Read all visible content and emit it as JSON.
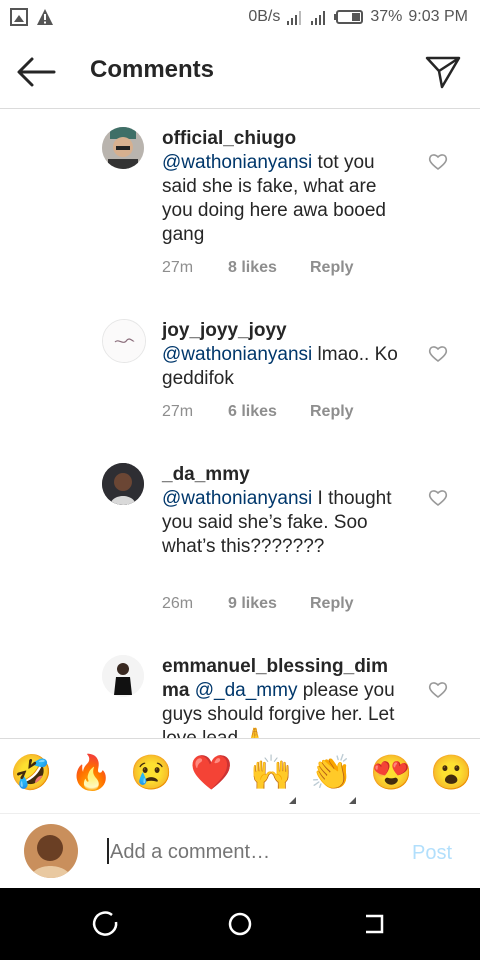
{
  "statusbar": {
    "network_speed": "0B/s",
    "battery": "37%",
    "time": "9:03 PM",
    "icons": [
      "image-icon",
      "warning-icon",
      "signal-icon",
      "signal-icon",
      "battery-icon"
    ]
  },
  "header": {
    "title": "Comments"
  },
  "comments": [
    {
      "username": "official_chiugo",
      "mention": "@wathonianyansi",
      "text": " tot you said she is fake, what are you doing here awa booed gang",
      "time": "27m",
      "likes": "8 likes",
      "reply": "Reply"
    },
    {
      "username": "joy_joyy_joyy",
      "mention": "@wathonianyansi",
      "text": " lmao.. Ko geddifok",
      "time": "27m",
      "likes": "6 likes",
      "reply": "Reply"
    },
    {
      "username": "_da_mmy",
      "mention": "@wathonianyansi",
      "text": "  I thought you said she’s fake. Soo what’s this???????",
      "time": "26m",
      "likes": "9 likes",
      "reply": "Reply"
    },
    {
      "username": "emmanuel_blessing_dimma",
      "mention": "@_da_mmy",
      "text": " please you guys should forgive her. Let love lead 🙏",
      "time": "",
      "likes": "",
      "reply": ""
    }
  ],
  "emoji_bar": [
    {
      "name": "rofl-emoji",
      "glyph": "🤣"
    },
    {
      "name": "fire-emoji",
      "glyph": "🔥"
    },
    {
      "name": "crying-emoji",
      "glyph": "😢"
    },
    {
      "name": "heart-emoji",
      "glyph": "❤️"
    },
    {
      "name": "raised-hands-emoji",
      "glyph": "🙌"
    },
    {
      "name": "clapping-emoji",
      "glyph": "👏"
    },
    {
      "name": "heart-eyes-emoji",
      "glyph": "😍"
    },
    {
      "name": "surprised-emoji",
      "glyph": "😮"
    }
  ],
  "composer": {
    "placeholder": "Add a comment…",
    "post_label": "Post"
  },
  "colors": {
    "mention": "#00376b",
    "meta": "#8e8e8e",
    "post_disabled": "#b2dffc",
    "text": "#262626"
  }
}
